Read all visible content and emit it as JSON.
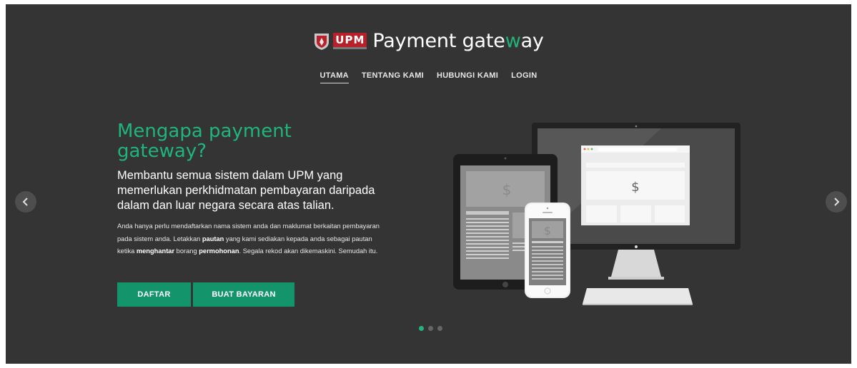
{
  "brand": {
    "logo_text": "UPM",
    "title_before": "Payment gate",
    "title_accent": "w",
    "title_after": "ay"
  },
  "nav": {
    "items": [
      {
        "label": "UTAMA",
        "active": true
      },
      {
        "label": "TENTANG KAMI",
        "active": false
      },
      {
        "label": "HUBUNGI KAMI",
        "active": false
      },
      {
        "label": "LOGIN",
        "active": false
      }
    ]
  },
  "hero": {
    "heading": "Mengapa payment gateway?",
    "subheading": "Membantu semua sistem dalam UPM yang memerlukan perkhidmatan pembayaran daripada dalam dan luar negara secara atas talian.",
    "body": {
      "part1": "Anda hanya perlu mendaftarkan nama sistem anda dan maklumat berkaitan pembayaran pada sistem anda. Letakkan ",
      "bold1": "pautan",
      "part2": " yang kami sediakan kepada anda sebagai pautan ketika ",
      "bold2": "menghantar",
      "part3": " borang ",
      "bold3": "permohonan",
      "part4": ". Segala rekod akan dikemaskini. Semudah itu."
    },
    "buttons": {
      "register": "DAFTAR",
      "pay": "BUAT BAYARAN"
    }
  },
  "carousel": {
    "slide_count": 3,
    "active_slide": 1
  },
  "illustration": {
    "currency_symbol": "$"
  },
  "colors": {
    "background": "#343434",
    "accent": "#1fb57d",
    "button": "#13946a"
  },
  "icons": {
    "prev": "chevron-left-icon",
    "next": "chevron-right-icon"
  }
}
